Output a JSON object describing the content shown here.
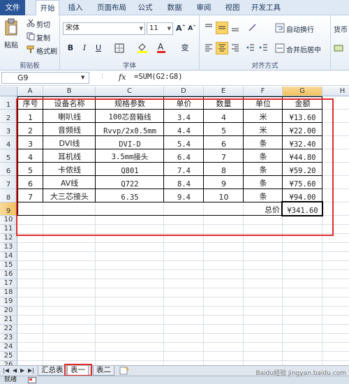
{
  "ribbon_tabs": [
    "文件",
    "开始",
    "插入",
    "页面布局",
    "公式",
    "数据",
    "审阅",
    "视图",
    "开发工具"
  ],
  "clipboard": {
    "paste": "粘贴",
    "cut": "剪切",
    "copy": "复制",
    "format_painter": "格式刷",
    "label": "剪贴板"
  },
  "font": {
    "name": "宋体",
    "size": "11",
    "grow": "Aˆ",
    "shrink": "Aˇ",
    "bold": "B",
    "italic": "I",
    "underline": "U",
    "phonetic": "变",
    "label": "字体"
  },
  "alignment": {
    "wrap_text": "自动换行",
    "merge_center": "合并后居中",
    "label": "对齐方式"
  },
  "number": {
    "format": "货币"
  },
  "formula_bar": {
    "name_box": "G9",
    "fx": "fx",
    "formula": "=SUM(G2:G8)"
  },
  "columns": [
    "A",
    "B",
    "C",
    "D",
    "E",
    "F",
    "G",
    "H"
  ],
  "rows": [
    "1",
    "2",
    "3",
    "4",
    "5",
    "6",
    "7",
    "8",
    "9",
    "10",
    "11",
    "12",
    "13",
    "14",
    "15",
    "16",
    "17",
    "18",
    "19",
    "20",
    "21",
    "22",
    "23",
    "24",
    "25",
    "26",
    "27"
  ],
  "table": {
    "headers": [
      "序号",
      "设备名称",
      "规格参数",
      "单价",
      "数量",
      "单位",
      "金额"
    ],
    "rows": [
      [
        "1",
        "喇叭线",
        "100芯音箱线",
        "3.4",
        "4",
        "米",
        "¥13.60"
      ],
      [
        "2",
        "音频线",
        "Rvvp/2x0.5mm",
        "4.4",
        "5",
        "米",
        "¥22.00"
      ],
      [
        "3",
        "DVI线",
        "DVI-D",
        "5.4",
        "6",
        "条",
        "¥32.40"
      ],
      [
        "4",
        "耳机线",
        "3.5mm接头",
        "6.4",
        "7",
        "条",
        "¥44.80"
      ],
      [
        "5",
        "卡侬线",
        "Q801",
        "7.4",
        "8",
        "条",
        "¥59.20"
      ],
      [
        "6",
        "AV线",
        "Q722",
        "8.4",
        "9",
        "条",
        "¥75.60"
      ],
      [
        "7",
        "大三芯接头",
        "6.35",
        "9.4",
        "10",
        "条",
        "¥94.00"
      ]
    ],
    "total_label": "总价",
    "total_value": "¥341.60"
  },
  "sheet_tabs": [
    "汇总表",
    "表一",
    "表二"
  ],
  "active_sheet": "表一",
  "status": "就绪",
  "watermark": "Baidu经验 jingyan.baidu.com",
  "colors": {
    "annotation": "#e02b2b",
    "file_tab": "#2a5699",
    "selection": "#f1c15f"
  }
}
